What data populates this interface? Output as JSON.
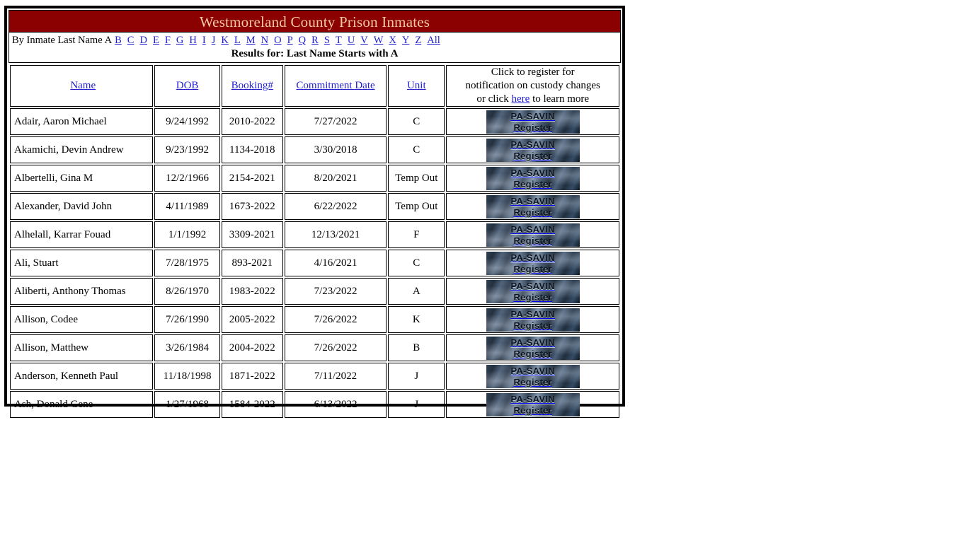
{
  "banner": {
    "title": "Westmoreland County Prison Inmates"
  },
  "nav": {
    "lead_label": "By Inmate Last Name",
    "current_letter": "A",
    "letters": [
      "B",
      "C",
      "D",
      "E",
      "F",
      "G",
      "H",
      "I",
      "J",
      "K",
      "L",
      "M",
      "N",
      "O",
      "P",
      "Q",
      "R",
      "S",
      "T",
      "U",
      "V",
      "W",
      "X",
      "Y",
      "Z"
    ],
    "all_label": "All",
    "results_line": "Results for: Last Name Starts with A"
  },
  "table": {
    "columns": [
      {
        "key": "name",
        "label": "Name"
      },
      {
        "key": "dob",
        "label": "DOB"
      },
      {
        "key": "book",
        "label": "Booking#"
      },
      {
        "key": "commit",
        "label": "Commitment Date"
      },
      {
        "key": "unit",
        "label": "Unit"
      }
    ],
    "register_header": {
      "line1": "Click to register for",
      "line2": "notification on custody changes",
      "line3_before": "or click ",
      "link": "here",
      "line3_after": " to learn more"
    },
    "register_button": {
      "top": "PA-SAVIN",
      "bottom": "Register"
    },
    "rows": [
      {
        "name": "Adair, Aaron Michael",
        "dob": "9/24/1992",
        "book": "2010-2022",
        "commit": "7/27/2022",
        "unit": "C"
      },
      {
        "name": "Akamichi, Devin Andrew",
        "dob": "9/23/1992",
        "book": "1134-2018",
        "commit": "3/30/2018",
        "unit": "C"
      },
      {
        "name": "Albertelli, Gina M",
        "dob": "12/2/1966",
        "book": "2154-2021",
        "commit": "8/20/2021",
        "unit": "Temp Out"
      },
      {
        "name": "Alexander, David John",
        "dob": "4/11/1989",
        "book": "1673-2022",
        "commit": "6/22/2022",
        "unit": "Temp Out"
      },
      {
        "name": "Alhelall, Karrar Fouad",
        "dob": "1/1/1992",
        "book": "3309-2021",
        "commit": "12/13/2021",
        "unit": "F"
      },
      {
        "name": "Ali, Stuart",
        "dob": "7/28/1975",
        "book": "893-2021",
        "commit": "4/16/2021",
        "unit": "C"
      },
      {
        "name": "Aliberti, Anthony Thomas",
        "dob": "8/26/1970",
        "book": "1983-2022",
        "commit": "7/23/2022",
        "unit": "A"
      },
      {
        "name": "Allison, Codee",
        "dob": "7/26/1990",
        "book": "2005-2022",
        "commit": "7/26/2022",
        "unit": "K"
      },
      {
        "name": "Allison, Matthew",
        "dob": "3/26/1984",
        "book": "2004-2022",
        "commit": "7/26/2022",
        "unit": "B"
      },
      {
        "name": "Anderson, Kenneth Paul",
        "dob": "11/18/1998",
        "book": "1871-2022",
        "commit": "7/11/2022",
        "unit": "J"
      },
      {
        "name": "Ash, Donald Gene",
        "dob": "1/27/1968",
        "book": "1584-2022",
        "commit": "6/13/2022",
        "unit": "J"
      }
    ]
  },
  "colors": {
    "banner_bg": "#8b0000",
    "banner_text": "#f2c9a0",
    "link": "#2121cf",
    "border": "#000000",
    "page_bg": "#ffffff"
  }
}
